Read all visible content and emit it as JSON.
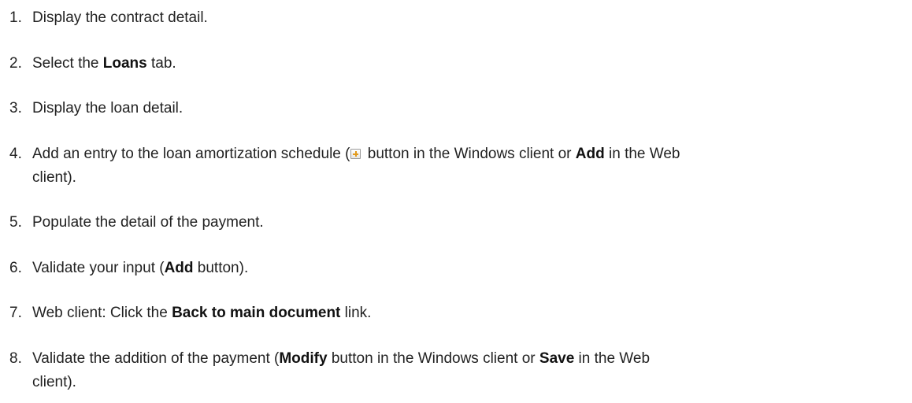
{
  "steps": [
    {
      "num": "1.",
      "parts": [
        "Display the contract detail."
      ]
    },
    {
      "num": "2.",
      "parts": [
        "Select the ",
        "Loans",
        " tab."
      ]
    },
    {
      "num": "3.",
      "parts": [
        "Display the loan detail."
      ]
    },
    {
      "num": "4.",
      "parts": [
        "Add an entry to the loan amortization schedule (",
        " button in the Windows client or ",
        "Add",
        " in the Web",
        "client)."
      ],
      "icon": "add-entry-icon"
    },
    {
      "num": "5.",
      "parts": [
        "Populate the detail of the payment."
      ]
    },
    {
      "num": "6.",
      "parts": [
        "Validate your input (",
        "Add",
        " button)."
      ]
    },
    {
      "num": "7.",
      "parts": [
        "Web client: Click the ",
        "Back to main document",
        " link."
      ]
    },
    {
      "num": "8.",
      "parts": [
        "Validate the addition of the payment (",
        "Modify",
        " button in the Windows client or ",
        "Save",
        " in the Web",
        "client)."
      ]
    }
  ]
}
